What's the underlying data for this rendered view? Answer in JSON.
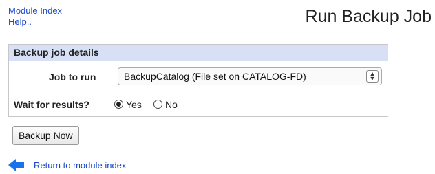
{
  "nav": {
    "module_index": "Module Index",
    "help": "Help.."
  },
  "page": {
    "title": "Run Backup Job"
  },
  "panel": {
    "header": "Backup job details",
    "job_label": "Job to run",
    "job_selected": "BackupCatalog (File set on CATALOG-FD)",
    "wait_label": "Wait for results?",
    "wait_options": [
      {
        "label": "Yes",
        "selected": true
      },
      {
        "label": "No",
        "selected": false
      }
    ]
  },
  "actions": {
    "backup_now": "Backup Now"
  },
  "footer": {
    "return_link": "Return to module index",
    "icon": "back-arrow-icon",
    "icon_color": "#1a73e8"
  }
}
